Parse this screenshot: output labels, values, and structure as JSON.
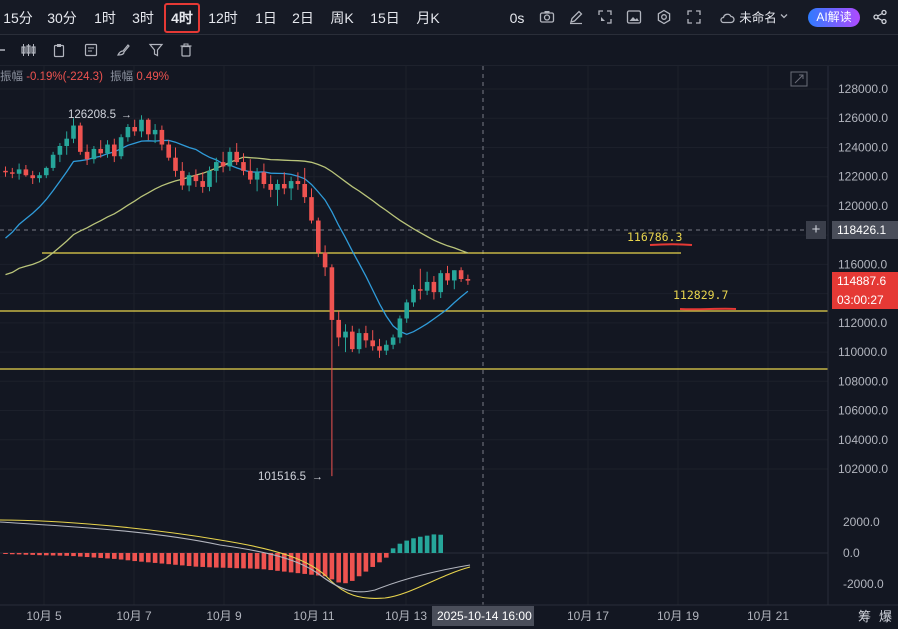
{
  "toolbar": {
    "timeframes": [
      "15分",
      "30分",
      "1时",
      "3时",
      "4时",
      "12时",
      "1日",
      "2日",
      "周K",
      "15日",
      "月K"
    ],
    "active_timeframe": "4时",
    "countdown": "0s",
    "layout_name": "未命名",
    "ai_button": "AI解读",
    "icons": [
      "camera-icon",
      "edit-icon",
      "select-icon",
      "image-icon",
      "settings-icon",
      "fullscreen-icon",
      "cloud-icon",
      "share-icon"
    ]
  },
  "drawing_tools": [
    "dashes-icon",
    "candle-icon",
    "clipboard-icon",
    "note-icon",
    "brush-icon",
    "filter-icon",
    "trash-icon"
  ],
  "info_line": {
    "label_change": "振幅",
    "change": "-0.19%(-224.3)",
    "label_amp": "振幅",
    "amp": "0.49%"
  },
  "price_axis": {
    "ticks": [
      "128000.0",
      "126000.0",
      "124000.0",
      "122000.0",
      "120000.0",
      "118000.0",
      "116000.0",
      "114000.0",
      "112000.0",
      "110000.0",
      "108000.0",
      "106000.0",
      "104000.0",
      "102000.0"
    ],
    "crosshair_price": "118426.1",
    "last_price": "114887.6",
    "countdown": "03:00:27"
  },
  "macd_axis": {
    "ticks": [
      "2000.0",
      "0.0",
      "-2000.0"
    ]
  },
  "time_axis": {
    "ticks": [
      "10月 5",
      "10月 7",
      "10月 9",
      "10月 11",
      "10月 13",
      "10月 17",
      "10月 19",
      "10月 21"
    ],
    "crosshair_time": "2025-10-14 16:00",
    "corner_labels": [
      "筹",
      "爆"
    ]
  },
  "annotations": {
    "high": "126208.5",
    "low": "101516.5",
    "line1": "116786.3",
    "line2": "112829.7"
  },
  "colors": {
    "up": "#26a69a",
    "down": "#ef5350",
    "ma_fast": "#2f9bd9",
    "ma_slow": "#b9c47a",
    "hline": "#e8d44d",
    "marker": "#e53935"
  },
  "chart_data": {
    "type": "candlestick",
    "ylim": [
      100000,
      129000
    ],
    "candles": [
      [
        122400,
        122700,
        122000,
        122300
      ],
      [
        122300,
        122600,
        121900,
        122200
      ],
      [
        122200,
        122900,
        121800,
        122500
      ],
      [
        122500,
        122800,
        122000,
        122100
      ],
      [
        122100,
        122400,
        121500,
        121900
      ],
      [
        121900,
        122300,
        121600,
        122100
      ],
      [
        122100,
        122700,
        121900,
        122600
      ],
      [
        122600,
        123700,
        122400,
        123500
      ],
      [
        123500,
        124300,
        123000,
        124100
      ],
      [
        124100,
        125100,
        123500,
        124600
      ],
      [
        124600,
        126000,
        124300,
        125500
      ],
      [
        125500,
        125700,
        123500,
        123700
      ],
      [
        123700,
        124200,
        122800,
        123200
      ],
      [
        123200,
        124100,
        122900,
        123900
      ],
      [
        123900,
        124500,
        123300,
        123600
      ],
      [
        123600,
        124500,
        123300,
        124200
      ],
      [
        124200,
        124600,
        123000,
        123400
      ],
      [
        123400,
        124900,
        123200,
        124700
      ],
      [
        124700,
        125600,
        124400,
        125400
      ],
      [
        125400,
        125900,
        124800,
        125100
      ],
      [
        125100,
        126200,
        124700,
        125900
      ],
      [
        125900,
        126000,
        124500,
        124900
      ],
      [
        124900,
        125600,
        124300,
        125200
      ],
      [
        125200,
        125500,
        123800,
        124200
      ],
      [
        124200,
        124500,
        123100,
        123300
      ],
      [
        123300,
        124000,
        122000,
        122400
      ],
      [
        122400,
        123000,
        121100,
        121400
      ],
      [
        121400,
        122300,
        121000,
        122100
      ],
      [
        122100,
        122500,
        121300,
        121700
      ],
      [
        121700,
        122300,
        120900,
        121300
      ],
      [
        121300,
        122700,
        121000,
        122400
      ],
      [
        122400,
        123300,
        121600,
        123000
      ],
      [
        123000,
        123700,
        122300,
        122700
      ],
      [
        122700,
        124000,
        122400,
        123700
      ],
      [
        123700,
        124300,
        122800,
        123000
      ],
      [
        123000,
        123600,
        122100,
        122400
      ],
      [
        122400,
        123200,
        121500,
        121800
      ],
      [
        121800,
        122600,
        121000,
        122300
      ],
      [
        122300,
        122900,
        121200,
        121500
      ],
      [
        121500,
        122100,
        120600,
        121100
      ],
      [
        121100,
        121800,
        120000,
        121500
      ],
      [
        121500,
        122300,
        120800,
        121200
      ],
      [
        121200,
        122000,
        120400,
        121700
      ],
      [
        121700,
        122300,
        121100,
        121500
      ],
      [
        121500,
        122600,
        120200,
        120600
      ],
      [
        120600,
        121200,
        118800,
        119000
      ],
      [
        119000,
        119200,
        116500,
        116800
      ],
      [
        116800,
        117300,
        115200,
        115800
      ],
      [
        115800,
        116000,
        101516.5,
        112200
      ],
      [
        112200,
        112800,
        110400,
        111000
      ],
      [
        111000,
        111900,
        110000,
        111400
      ],
      [
        111400,
        111800,
        110000,
        110200
      ],
      [
        110200,
        111600,
        109900,
        111300
      ],
      [
        111300,
        111800,
        110300,
        110800
      ],
      [
        110800,
        111500,
        110100,
        110400
      ],
      [
        110400,
        110900,
        109600,
        110100
      ],
      [
        110100,
        110800,
        109800,
        110500
      ],
      [
        110500,
        111200,
        110200,
        111000
      ],
      [
        111000,
        112500,
        110600,
        112300
      ],
      [
        112300,
        113600,
        112000,
        113400
      ],
      [
        113400,
        114600,
        113100,
        114300
      ],
      [
        114300,
        115700,
        113600,
        114200
      ],
      [
        114200,
        115500,
        113900,
        114800
      ],
      [
        114800,
        115200,
        113600,
        114100
      ],
      [
        114100,
        115600,
        113700,
        115400
      ],
      [
        115400,
        115900,
        114600,
        114900
      ],
      [
        114900,
        115600,
        114300,
        115600
      ],
      [
        115600,
        115800,
        114800,
        115000
      ],
      [
        115000,
        115300,
        114600,
        114887.6
      ]
    ],
    "macd_hist": [
      -60,
      -80,
      -90,
      -110,
      -120,
      -140,
      -150,
      -160,
      -170,
      -180,
      -200,
      -230,
      -260,
      -290,
      -320,
      -350,
      -380,
      -420,
      -470,
      -520,
      -560,
      -600,
      -640,
      -680,
      -720,
      -760,
      -800,
      -840,
      -880,
      -900,
      -920,
      -940,
      -950,
      -960,
      -980,
      -990,
      -1000,
      -1020,
      -1050,
      -1100,
      -1150,
      -1200,
      -1250,
      -1300,
      -1350,
      -1400,
      -1450,
      -1500,
      -1700,
      -1900,
      -1950,
      -1800,
      -1500,
      -1200,
      -900,
      -600,
      -300,
      300,
      600,
      800,
      950,
      1050,
      1120,
      1200,
      1180
    ]
  }
}
